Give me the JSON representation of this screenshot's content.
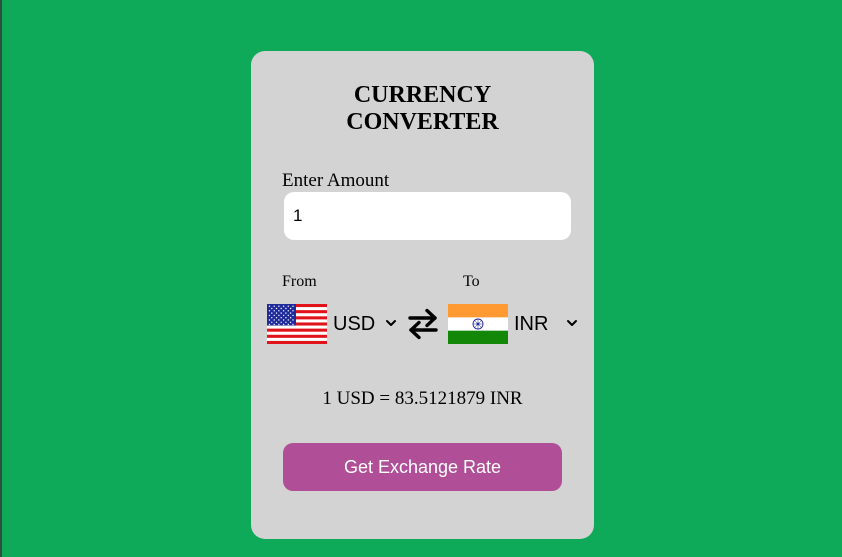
{
  "app": {
    "title_line1": "CURRENCY",
    "title_line2": "CONVERTER"
  },
  "amount": {
    "label": "Enter Amount",
    "value": "1"
  },
  "from": {
    "label": "From",
    "currency": "USD",
    "flag": "us-flag-icon"
  },
  "to": {
    "label": "To",
    "currency": "INR",
    "flag": "india-flag-icon"
  },
  "swap": {
    "icon": "swap-arrows-icon"
  },
  "result": {
    "text": "1 USD = 83.5121879 INR"
  },
  "button": {
    "label": "Get Exchange Rate"
  },
  "colors": {
    "background": "#0eaa5a",
    "card": "#d3d3d3",
    "button": "#b04f97",
    "button_text": "#ffffff"
  }
}
